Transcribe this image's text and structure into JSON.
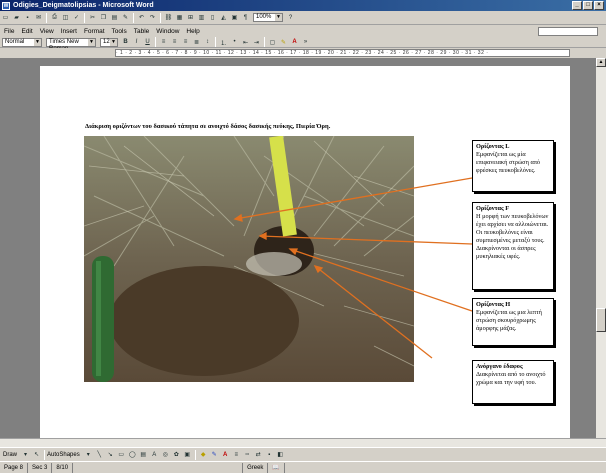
{
  "window": {
    "title": "Odigies_Deigmatolipsias - Microsoft Word",
    "app_icon": "W"
  },
  "menu": [
    "File",
    "Edit",
    "View",
    "Insert",
    "Format",
    "Tools",
    "Table",
    "Window",
    "Help"
  ],
  "toolbar": {
    "zoom": "100%",
    "style": "Normal",
    "font": "Times New Roman",
    "size": "12"
  },
  "document": {
    "caption": "Διάκριση οριζόντων του δασικού τάπητα σε ανοιχτό δάσος δασικής πεύκης, Πιερία Όρη.",
    "labels": [
      {
        "heading": "Ορίζοντας L",
        "body": "Εμφανίζεται ως μία επιφανειακή στρώση από φρέσκες πευκοβελόνες."
      },
      {
        "heading": "Ορίζοντας F",
        "body": "Η μορφή των πευκοβελόνων έχει αρχίσει να αλλοιώνεται. Οι πευκοβελόνες είναι συμπιεσμένες μεταξύ τους. Διακρίνονται οι άσπρες μυκηλιακές υφές."
      },
      {
        "heading": "Ορίζοντας H",
        "body": "Εμφανίζεται ως μια λεπτή στρώση σκουρόχρωμης άμορφης μάζας."
      },
      {
        "heading": "Ανόργανο έδαφος",
        "body": "Διακρίνεται από το ανοιχτό χρώμα και την υφή του."
      }
    ]
  },
  "drawing_toolbar": {
    "draw_label": "Draw",
    "autoshapes_label": "AutoShapes"
  },
  "status": {
    "page": "Page 8",
    "section": "Sec 3",
    "page_of": "8/10",
    "language": "Greek"
  },
  "colors": {
    "arrow": "#e07020",
    "titlebar_start": "#0a246a",
    "titlebar_end": "#3a6ea5"
  }
}
